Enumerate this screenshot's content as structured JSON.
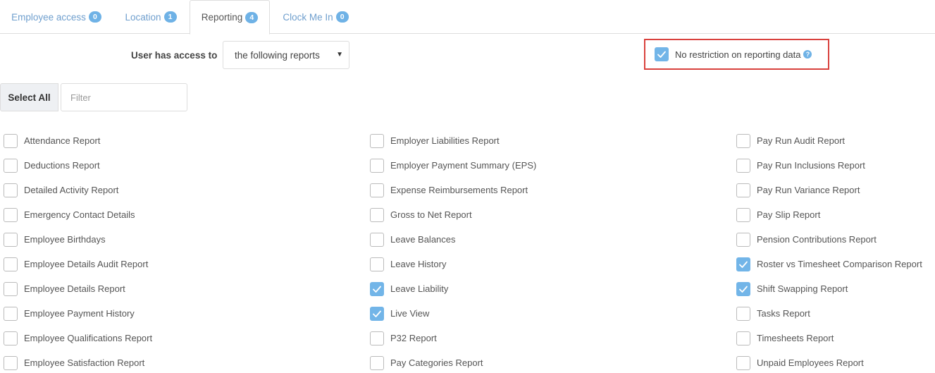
{
  "tabs": [
    {
      "label": "Employee access",
      "count": "0"
    },
    {
      "label": "Location",
      "count": "1"
    },
    {
      "label": "Reporting",
      "count": "4"
    },
    {
      "label": "Clock Me In",
      "count": "0"
    }
  ],
  "access": {
    "label": "User has access to",
    "select_value": "the following reports"
  },
  "no_restriction": {
    "label": "No restriction on reporting data",
    "checked": true,
    "help": "?"
  },
  "controls": {
    "select_all": "Select All",
    "filter_placeholder": "Filter",
    "filter_value": ""
  },
  "colors": {
    "accent": "#72b5e8",
    "tab_link": "#6f9fce",
    "highlight_border": "#d9413d"
  },
  "reports": {
    "col1": [
      {
        "label": "Attendance Report",
        "checked": false
      },
      {
        "label": "Deductions Report",
        "checked": false
      },
      {
        "label": "Detailed Activity Report",
        "checked": false
      },
      {
        "label": "Emergency Contact Details",
        "checked": false
      },
      {
        "label": "Employee Birthdays",
        "checked": false
      },
      {
        "label": "Employee Details Audit Report",
        "checked": false
      },
      {
        "label": "Employee Details Report",
        "checked": false
      },
      {
        "label": "Employee Payment History",
        "checked": false
      },
      {
        "label": "Employee Qualifications Report",
        "checked": false
      },
      {
        "label": "Employee Satisfaction Report",
        "checked": false
      }
    ],
    "col2": [
      {
        "label": "Employer Liabilities Report",
        "checked": false
      },
      {
        "label": "Employer Payment Summary (EPS)",
        "checked": false
      },
      {
        "label": "Expense Reimbursements Report",
        "checked": false
      },
      {
        "label": "Gross to Net Report",
        "checked": false
      },
      {
        "label": "Leave Balances",
        "checked": false
      },
      {
        "label": "Leave History",
        "checked": false
      },
      {
        "label": "Leave Liability",
        "checked": true
      },
      {
        "label": "Live View",
        "checked": true
      },
      {
        "label": "P32 Report",
        "checked": false
      },
      {
        "label": "Pay Categories Report",
        "checked": false
      }
    ],
    "col3": [
      {
        "label": "Pay Run Audit Report",
        "checked": false
      },
      {
        "label": "Pay Run Inclusions Report",
        "checked": false
      },
      {
        "label": "Pay Run Variance Report",
        "checked": false
      },
      {
        "label": "Pay Slip Report",
        "checked": false
      },
      {
        "label": "Pension Contributions Report",
        "checked": false
      },
      {
        "label": "Roster vs Timesheet Comparison Report",
        "checked": true
      },
      {
        "label": "Shift Swapping Report",
        "checked": true
      },
      {
        "label": "Tasks Report",
        "checked": false
      },
      {
        "label": "Timesheets Report",
        "checked": false
      },
      {
        "label": "Unpaid Employees Report",
        "checked": false
      }
    ]
  }
}
